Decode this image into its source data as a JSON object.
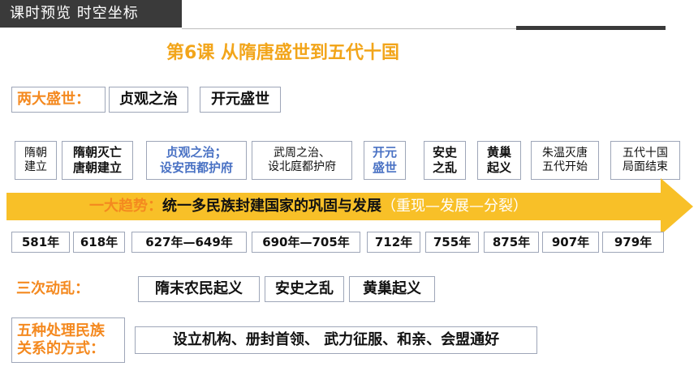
{
  "header": {
    "tab_label": "课时预览  时空坐标"
  },
  "lesson": {
    "title": "第6课   从隋唐盛世到五代十国"
  },
  "prosperity": {
    "label": "两大盛世：",
    "items": [
      "贞观之治",
      "开元盛世"
    ]
  },
  "timeline": {
    "events": [
      {
        "line1": "隋朝",
        "line2": "建立",
        "style": "normal"
      },
      {
        "line1": "隋朝灭亡",
        "line2": "唐朝建立",
        "style": "bold"
      },
      {
        "line1": "贞观之治；",
        "line2": "设安西都护府",
        "style": "blue"
      },
      {
        "line1": "武周之治、",
        "line2": "设北庭都护府",
        "style": "normal"
      },
      {
        "line1": "开元",
        "line2": "盛世",
        "style": "blue"
      },
      {
        "line1": "安史",
        "line2": "之乱",
        "style": "bold"
      },
      {
        "line1": "黄巢",
        "line2": "起义",
        "style": "bold"
      },
      {
        "line1": "朱温灭唐",
        "line2": "五代开始",
        "style": "normal"
      },
      {
        "line1": "五代十国",
        "line2": "局面结束",
        "style": "normal"
      }
    ],
    "trend_label": "一大趋势：",
    "trend_text": "统一多民族封建国家的巩固与发展",
    "trend_paren": "（重现—发展—分裂）",
    "years": [
      "581年",
      "618年",
      "627年—649年",
      "690年—705年",
      "712年",
      "755年",
      "875年",
      "907年",
      "979年"
    ],
    "arrow_color": "#f8c028"
  },
  "turmoil": {
    "label": "三次动乱：",
    "items": [
      "隋末农民起义",
      "安史之乱",
      "黄巢起义"
    ]
  },
  "ethnic": {
    "label_line1": "五种处理民族",
    "label_line2": "关系的方式：",
    "text": "设立机构、册封首领、 武力征服、和亲、会盟通好"
  },
  "colors": {
    "accent_orange": "#f4891f",
    "title_orange": "#f2a51a",
    "header_dark": "#3a3a3a",
    "blue": "#4a72c4"
  }
}
